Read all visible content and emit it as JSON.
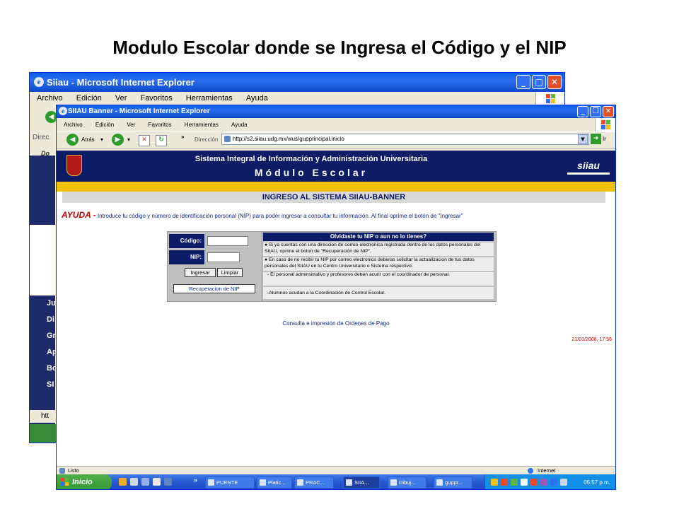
{
  "slide": {
    "title": "Modulo Escolar donde se Ingresa el Código y el NIP"
  },
  "back_window": {
    "title": "Siiau - Microsoft Internet Explorer",
    "menu": [
      "Archivo",
      "Edición",
      "Ver",
      "Favoritos",
      "Herramientas",
      "Ayuda"
    ],
    "toolbar_stub": "Direc",
    "links_stub": "Do",
    "sidebar_stubs": [
      "Ju",
      "Di",
      "Gr",
      "Ap",
      "Bo",
      "SI"
    ],
    "status_stub": "htt"
  },
  "front_window": {
    "title": "SIIAU Banner - Microsoft Internet Explorer",
    "menu": [
      "Archivo",
      "Edición",
      "Ver",
      "Favoritos",
      "Herramientas",
      "Ayuda"
    ],
    "toolbar": {
      "back": "Atrás",
      "chevron": "»",
      "address_label": "Dirección",
      "url": "http://s2.siiau.udg.mx/wus/gupprincipal.inicio",
      "go": "Ir"
    },
    "status": {
      "left": "Listo",
      "zone": "Internet"
    }
  },
  "page": {
    "banner_line1": "Sistema Integral de Información y Administración Universitaria",
    "banner_line2": "Módulo Escolar",
    "logo_text": "siiau",
    "heading": "INGRESO AL SISTEMA SIIAU-BANNER",
    "help_label": "AYUDA -",
    "help_text": "Introduce tu código y número de identificación personal (NIP) para poder ingresar a consultar tu información. Al final oprime el botón de \"Ingresar\"",
    "login": {
      "code_label": "Código:",
      "nip_label": "NIP:",
      "login_button": "Ingresar",
      "clear_button": "Limpiar",
      "recover_button": "Recuperacion de NIP"
    },
    "info": {
      "title": "Olvidaste tu NIP o aun no lo tienes?",
      "bullet1": "●  Si ya cuentas con una direccion de correo electronica registrada dentro de los datos personales del SIIAU, oprime el boton de \"Recuperación de NIP\".",
      "bullet2": "●  En caso de no recibir tu NIP por correo electronico deberas solicitar la actualizacion de tus datos personales del SIIAU en tu Centro Universitario o Sistema respectivo.",
      "note1": "- El personal adminsitrativo y profesores deben acurir con el coordinador de personal.",
      "note2": "-Alumnos acudan a la Coordinación de Control Escolar."
    },
    "orders_link": "Consulta e impresión de Ordenes de Pago",
    "timestamp": "21/01/2008, 17:56"
  },
  "taskbar": {
    "start": "Inicio",
    "chevron": "»",
    "tasks": [
      "PUENTE",
      "Platic...",
      "PRAC...",
      "SIIA...",
      "Dibuj...",
      "guppr..."
    ],
    "clock": "05:57 p.m."
  },
  "colors": {
    "navy": "#0d1c66",
    "gold": "#f2c200",
    "xp_blue": "#2557d0",
    "alert_red": "#c00000"
  }
}
